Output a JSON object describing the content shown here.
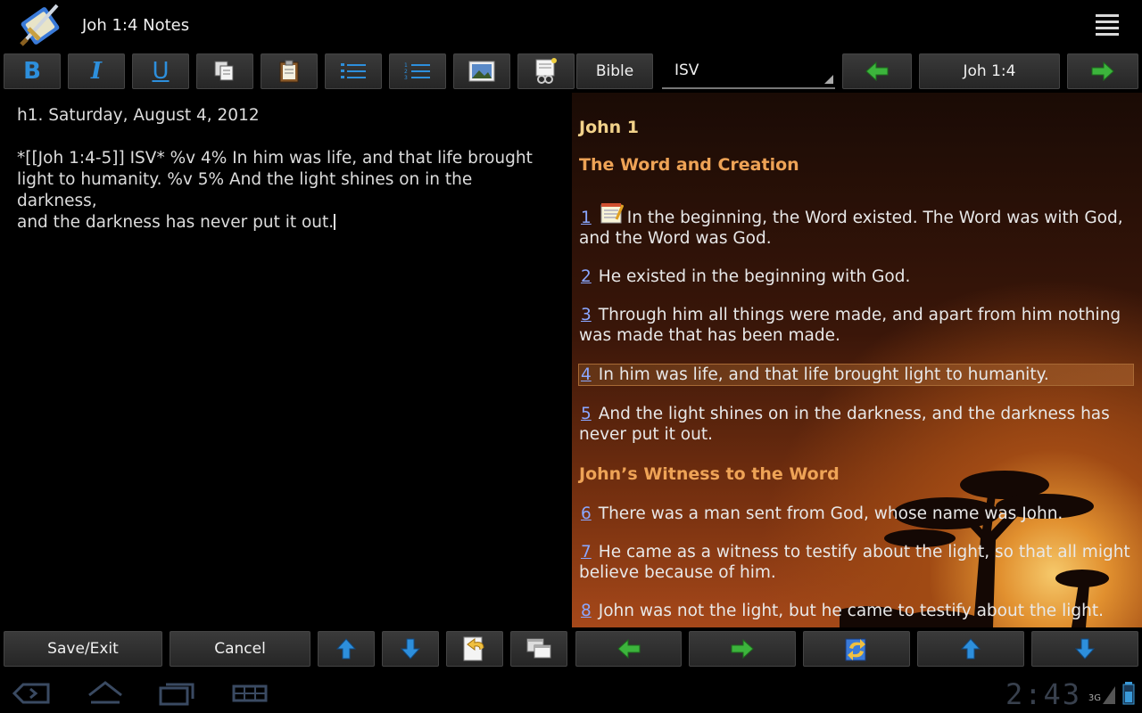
{
  "actionbar": {
    "title": "Joh 1:4 Notes",
    "app_icon": "sword-and-book-icon",
    "menu_icon": "overflow-menu-icon"
  },
  "toolbar": {
    "bold_label": "B",
    "italic_label": "I",
    "underline_label": "U",
    "bible_label": "Bible",
    "translation": "ISV",
    "reference": "Joh 1:4"
  },
  "editor": {
    "heading_line": "h1. Saturday, August 4, 2012",
    "body_lines": [
      "*[[Joh 1:4-5]] ISV* %v 4% In him was life, and that life brought",
      "light to humanity. %v 5% And the light shines on in the darkness,",
      "and the darkness has never put it out."
    ]
  },
  "bible": {
    "chapter": "John 1",
    "section1": "The Word and Creation",
    "section2": "John’s Witness to the Word",
    "verses": [
      {
        "num": "1",
        "text": "In the beginning, the Word existed. The Word was with God, and the Word was God."
      },
      {
        "num": "2",
        "text": "He existed in the beginning with God."
      },
      {
        "num": "3",
        "text": "Through him all things were made, and apart from him nothing was made that has been made."
      },
      {
        "num": "4",
        "text": "In him was life, and that life brought light to humanity."
      },
      {
        "num": "5",
        "text": "And the light shines on in the darkness, and the darkness has never put it out."
      },
      {
        "num": "6",
        "text": "There was a man sent from God, whose name was John."
      },
      {
        "num": "7",
        "text": "He came as a witness to testify about the light, so that all might believe because of him."
      },
      {
        "num": "8",
        "text": "John was not the light, but he came to testify about the light."
      }
    ],
    "highlight_color": "#a86a35"
  },
  "bottombar": {
    "save_label": "Save/Exit",
    "cancel_label": "Cancel"
  },
  "system": {
    "clock": "2:43",
    "network": "3G"
  },
  "colors": {
    "accent_blue": "#2d8fdc",
    "arrow_green": "#3cb43c",
    "chapter_gold": "#f2d28a",
    "section_orange": "#eea356",
    "verse_link": "#8aa7ff"
  }
}
